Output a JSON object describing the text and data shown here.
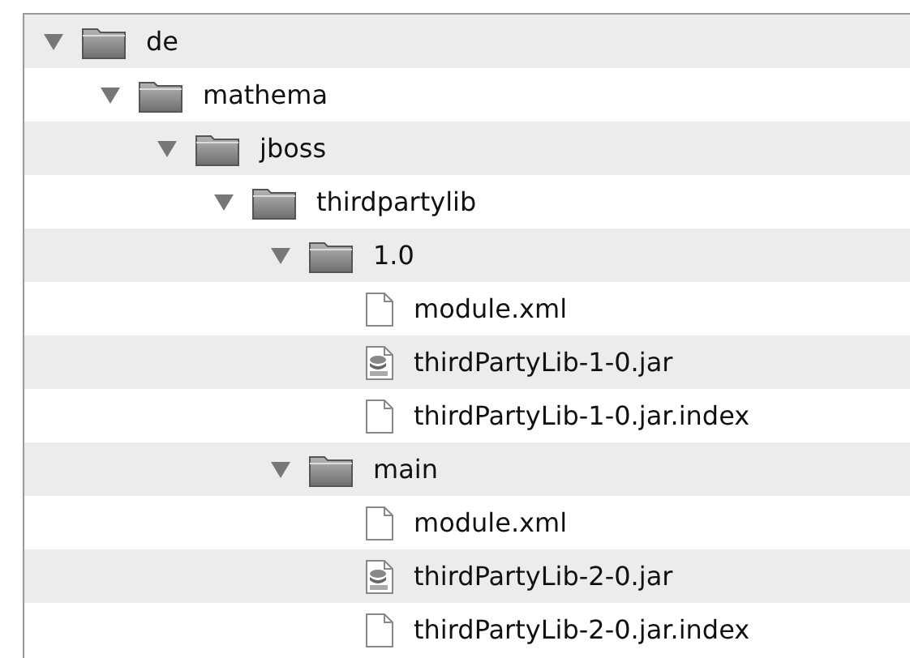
{
  "tree": [
    {
      "kind": "folder",
      "name": "de",
      "expanded": true,
      "children": [
        {
          "kind": "folder",
          "name": "mathema",
          "expanded": true,
          "children": [
            {
              "kind": "folder",
              "name": "jboss",
              "expanded": true,
              "children": [
                {
                  "kind": "folder",
                  "name": "thirdpartylib",
                  "expanded": true,
                  "children": [
                    {
                      "kind": "folder",
                      "name": "1.0",
                      "expanded": true,
                      "children": [
                        {
                          "kind": "file",
                          "name": "module.xml"
                        },
                        {
                          "kind": "jar",
                          "name": "thirdPartyLib-1-0.jar"
                        },
                        {
                          "kind": "file",
                          "name": "thirdPartyLib-1-0.jar.index"
                        }
                      ]
                    },
                    {
                      "kind": "folder",
                      "name": "main",
                      "expanded": true,
                      "children": [
                        {
                          "kind": "file",
                          "name": "module.xml"
                        },
                        {
                          "kind": "jar",
                          "name": "thirdPartyLib-2-0.jar"
                        },
                        {
                          "kind": "file",
                          "name": "thirdPartyLib-2-0.jar.index"
                        }
                      ]
                    }
                  ]
                }
              ]
            }
          ]
        }
      ]
    }
  ]
}
